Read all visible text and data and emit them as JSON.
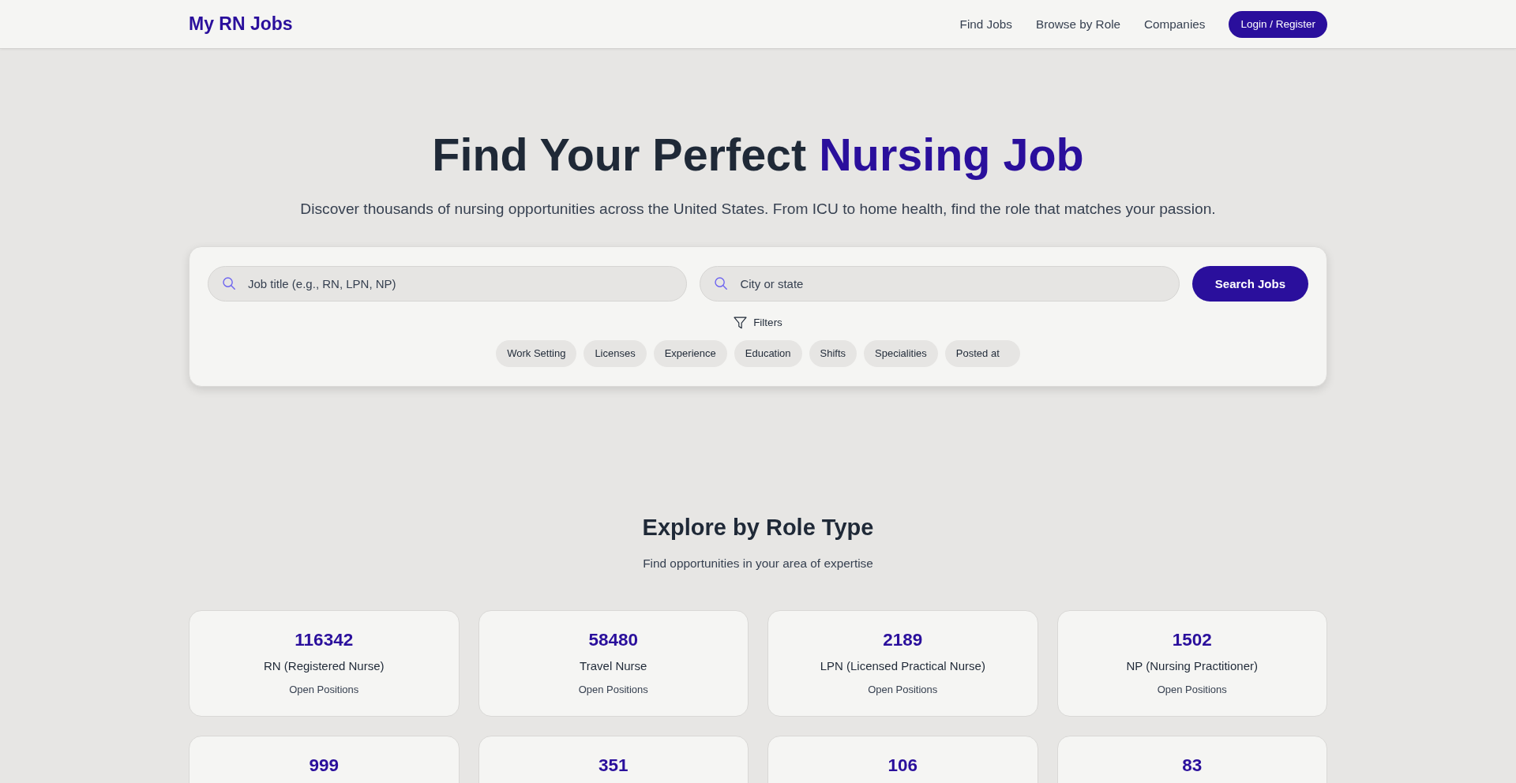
{
  "header": {
    "logo": "My RN Jobs",
    "nav": [
      "Find Jobs",
      "Browse by Role",
      "Companies"
    ],
    "login_button": "Login / Register"
  },
  "hero": {
    "title": "Find Your Perfect",
    "title_highlight": "Nursing Job",
    "subtitle": "Discover thousands of nursing opportunities across the United States. From ICU to home health, find the role that matches your passion."
  },
  "search": {
    "job_field": {
      "placeholder": "Job title (e.g., RN, LPN, NP)"
    },
    "location_field": {
      "placeholder": "City or state"
    },
    "button": "Search Jobs",
    "filters_label": "Filters",
    "filter_chips": [
      "Work Setting",
      "Licenses",
      "Experience",
      "Education",
      "Shifts",
      "Specialities",
      "Posted at"
    ]
  },
  "roles": {
    "title": "Explore by Role Type",
    "subtitle": "Find opportunities in your area of expertise",
    "cards": [
      {
        "count": "116342",
        "role": "RN (Registered Nurse)",
        "caption": "Open Positions"
      },
      {
        "count": "58480",
        "role": "Travel Nurse",
        "caption": "Open Positions"
      },
      {
        "count": "2189",
        "role": "LPN (Licensed Practical Nurse)",
        "caption": "Open Positions"
      },
      {
        "count": "1502",
        "role": "NP (Nursing Practitioner)",
        "caption": "Open Positions"
      },
      {
        "count": "999"
      },
      {
        "count": "351"
      },
      {
        "count": "106"
      },
      {
        "count": "83"
      }
    ]
  }
}
